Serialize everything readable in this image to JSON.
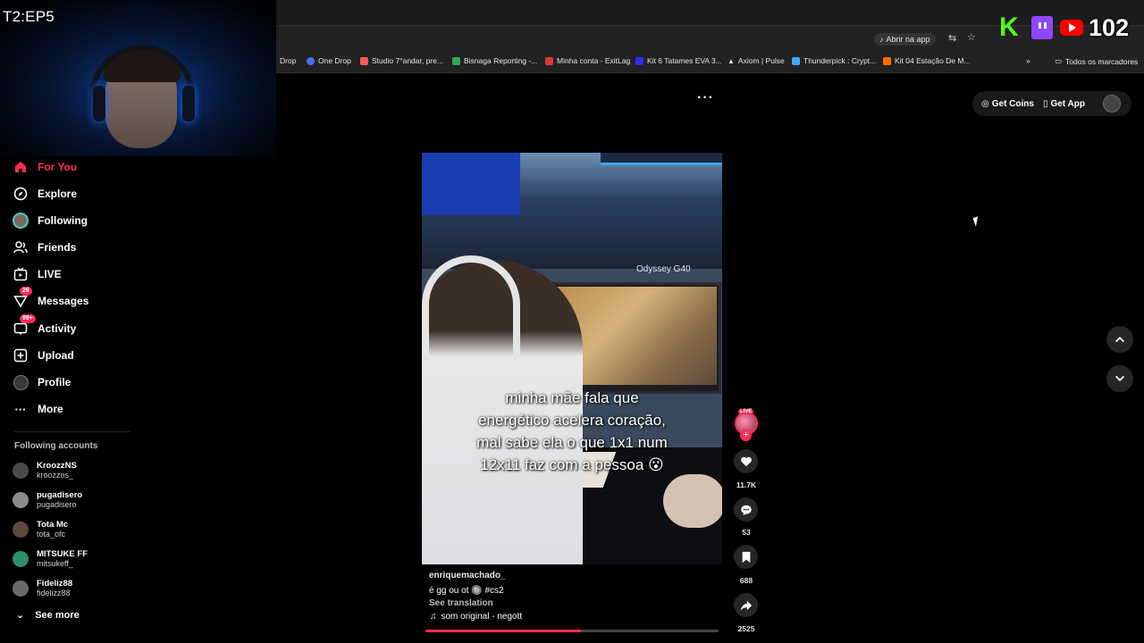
{
  "overlay": {
    "episode": "T2:EP5",
    "viewer_count": "102"
  },
  "browser": {
    "open_in_app": "Abrir na app",
    "bookmarks": [
      {
        "label": "Drop",
        "color": "#222222"
      },
      {
        "label": "One Drop",
        "color": "#4c6ef5"
      },
      {
        "label": "Studio 7°andar, pre...",
        "color": "#ff5a5f"
      },
      {
        "label": "Bisnaga Reporting -...",
        "color": "#34a853"
      },
      {
        "label": "Minha conta - ExitLag",
        "color": "#d9363e"
      },
      {
        "label": "Kit 6 Tatames EVA 3...",
        "color": "#2b2bff"
      },
      {
        "label": "Axiom | Pulse",
        "color": "#ffffff"
      },
      {
        "label": "Thunderpick : Crypt...",
        "color": "#3da9fc"
      },
      {
        "label": "Kit 04 Estação De M...",
        "color": "#ff6a00"
      }
    ],
    "all_bookmarks": "Todos os marcadores"
  },
  "sidebar": {
    "nav": [
      {
        "label": "For You",
        "icon": "home-icon"
      },
      {
        "label": "Explore",
        "icon": "compass-icon"
      },
      {
        "label": "Following",
        "icon": "following-avatar-icon"
      },
      {
        "label": "Friends",
        "icon": "friends-icon"
      },
      {
        "label": "LIVE",
        "icon": "live-icon"
      },
      {
        "label": "Messages",
        "icon": "message-icon",
        "badge": "26"
      },
      {
        "label": "Activity",
        "icon": "activity-icon",
        "badge": "99+"
      },
      {
        "label": "Upload",
        "icon": "upload-icon"
      },
      {
        "label": "Profile",
        "icon": "profile-avatar-icon"
      },
      {
        "label": "More",
        "icon": "more-icon"
      }
    ],
    "following_title": "Following accounts",
    "accounts": [
      {
        "name": "KroozzNS",
        "handle": "kroozzns_"
      },
      {
        "name": "pugadisero",
        "handle": "pugadisero"
      },
      {
        "name": "Tota Mc",
        "handle": "tota_ofc"
      },
      {
        "name": "MITSUKE FF",
        "handle": "mitsukeff_"
      },
      {
        "name": "Fideliz88",
        "handle": "fidelizz88"
      }
    ],
    "see_more": "See more"
  },
  "header": {
    "get_coins": "Get Coins",
    "get_app": "Get App"
  },
  "video": {
    "monitor_brand": "Odyssey G40",
    "caption": [
      "minha mãe fala que",
      "energético acelera coração,",
      "mal sabe ela o que 1x1 num",
      "12x11 faz com a pessoa 😮"
    ],
    "author": "enriquemachado_",
    "description": "é gg ou ot 🔘 #cs2",
    "see_translation": "See translation",
    "sound": "som original - negott",
    "progress": 0.53
  },
  "actions": {
    "live_badge": "LIVE",
    "likes": "11.7K",
    "comments": "53",
    "saves": "688",
    "shares": "2525"
  },
  "colors": {
    "accent": "#fe2c55",
    "background": "#000000"
  }
}
